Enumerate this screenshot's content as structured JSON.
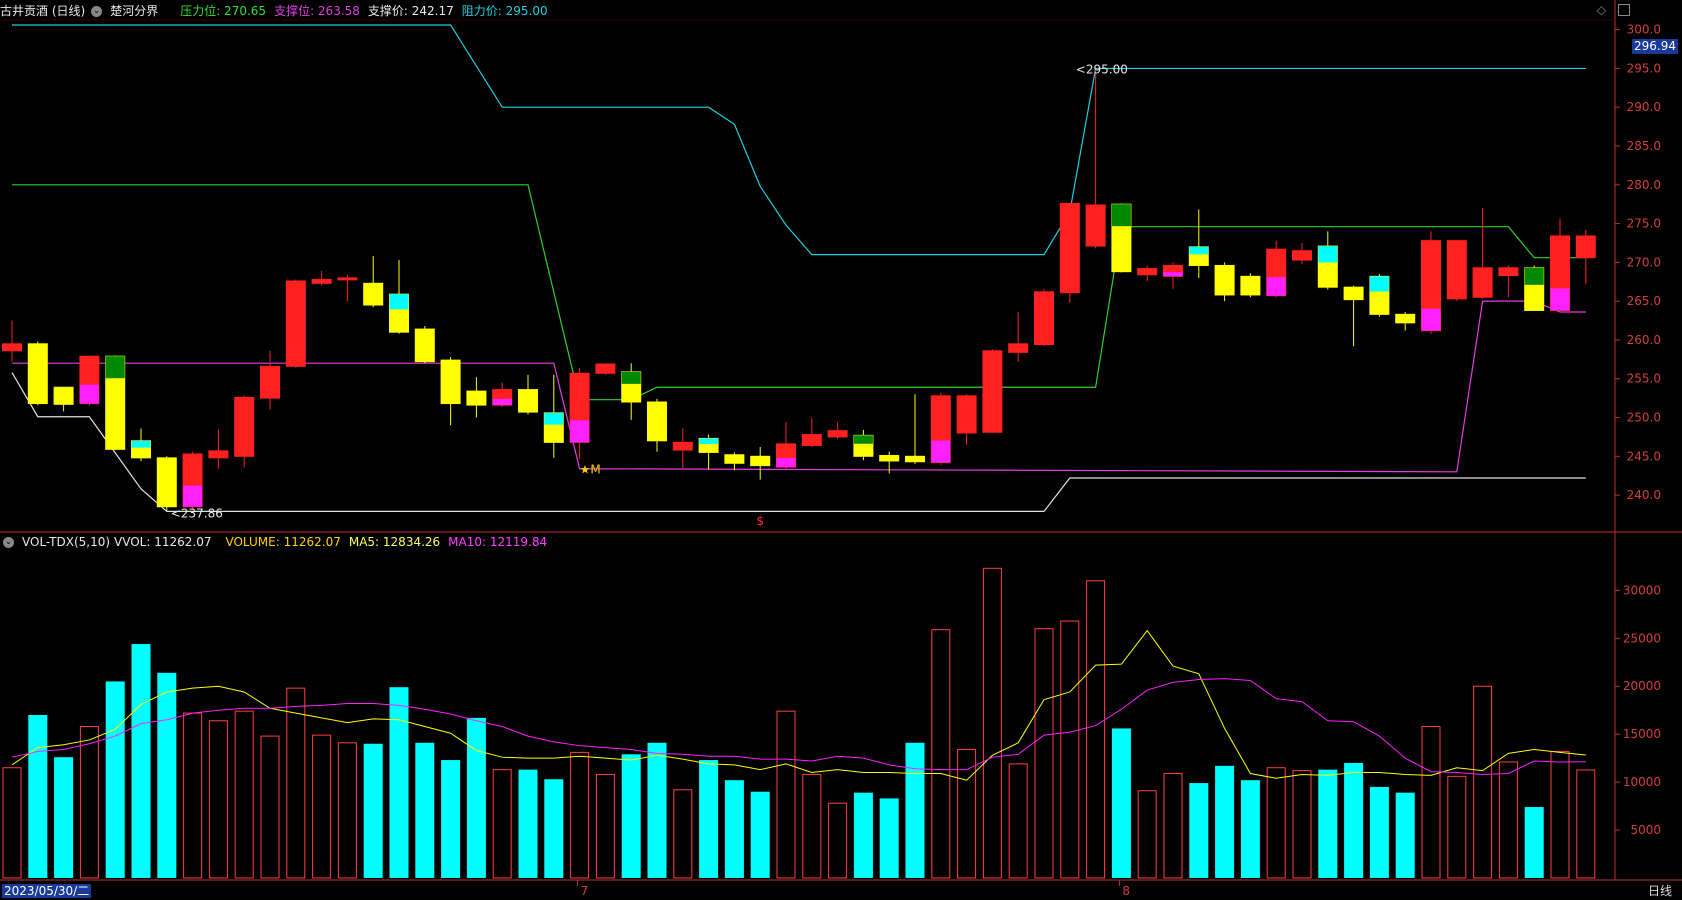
{
  "header": {
    "stock_title": "古井贡酒 (日线)",
    "indicator_name": "楚河分界",
    "pressure_label": "压力位: 270.65",
    "support_label": "支撑位: 263.58",
    "support_price_label": "支撑价: 242.17",
    "resistance_label": "阻力价: 295.00"
  },
  "volume_header": {
    "indicator_name": "VOL-TDX(5,10)",
    "vvol": "VVOL: 11262.07",
    "volume": "VOLUME: 11262.07",
    "ma5": "MA5: 12834.26",
    "ma10": "MA10: 12119.84"
  },
  "footer": {
    "date": "2023/05/30/二",
    "period": "日线",
    "month_marks": [
      {
        "index": 22,
        "label": "7"
      },
      {
        "index": 43,
        "label": "8"
      }
    ]
  },
  "current_price_tag": "296.94",
  "colors": {
    "up": "#ff2020",
    "down_yellow": "#ffff00",
    "cyan": "#00ffff",
    "magenta": "#ff20ff",
    "green": "#008800",
    "resistance_line": "#20d0e0",
    "pressure_line": "#30d030",
    "support_line": "#e040e0",
    "support_price_line": "#e0e0e0",
    "axis": "#c03030",
    "vol_up": "#ff4040",
    "vol_down": "#00ffff",
    "ma5": "#ffff00",
    "ma10": "#ff20ff"
  },
  "chart_data": {
    "type": "candlestick",
    "price_axis": {
      "ylim": [
        235.5,
        301.5
      ],
      "ticks": [
        240.0,
        245.0,
        250.0,
        255.0,
        260.0,
        265.0,
        270.0,
        275.0,
        280.0,
        285.0,
        290.0,
        295.0,
        300.0
      ]
    },
    "volume_axis": {
      "ylim": [
        0,
        34000
      ],
      "ticks": [
        5000,
        10000,
        15000,
        20000,
        25000,
        30000
      ]
    },
    "annotations": [
      {
        "index": 41,
        "price": 295.0,
        "text": "295.00"
      },
      {
        "index": 6,
        "price": 237.86,
        "text": "237.86"
      },
      {
        "index": 22,
        "price": 243.4,
        "text": "★M"
      },
      {
        "index": 29,
        "price": 236.8,
        "text": "$"
      }
    ],
    "candles": [
      {
        "o": 258.6,
        "h": 262.5,
        "l": 257.2,
        "c": 259.5,
        "v": 11500,
        "s": "red"
      },
      {
        "o": 259.5,
        "h": 259.8,
        "l": 251.6,
        "c": 251.8,
        "v": 17000,
        "s": "yellow"
      },
      {
        "o": 251.7,
        "h": 253.5,
        "l": 250.8,
        "c": 253.9,
        "v": 12600,
        "s": "yellow"
      },
      {
        "o": 251.8,
        "h": 258.0,
        "l": 251.5,
        "c": 257.9,
        "v": 15800,
        "s": "red",
        "ext": "magenta"
      },
      {
        "o": 257.9,
        "h": 258.0,
        "l": 245.8,
        "c": 245.9,
        "v": 20500,
        "s": "yellow",
        "ext": "green"
      },
      {
        "o": 247.0,
        "h": 248.6,
        "l": 244.4,
        "c": 244.8,
        "v": 24400,
        "s": "yellow",
        "ext": "cyan"
      },
      {
        "o": 244.8,
        "h": 245.0,
        "l": 238.0,
        "c": 238.5,
        "v": 21400,
        "s": "yellow"
      },
      {
        "o": 238.5,
        "h": 245.6,
        "l": 238.2,
        "c": 245.3,
        "v": 17200,
        "s": "red",
        "ext": "magenta"
      },
      {
        "o": 244.8,
        "h": 248.5,
        "l": 243.4,
        "c": 245.7,
        "v": 16400,
        "s": "red"
      },
      {
        "o": 245.0,
        "h": 252.8,
        "l": 243.6,
        "c": 252.6,
        "v": 17400,
        "s": "red"
      },
      {
        "o": 252.5,
        "h": 258.6,
        "l": 251.0,
        "c": 256.6,
        "v": 14800,
        "s": "red"
      },
      {
        "o": 256.6,
        "h": 267.8,
        "l": 256.4,
        "c": 267.6,
        "v": 19800,
        "s": "red"
      },
      {
        "o": 267.3,
        "h": 268.9,
        "l": 267.0,
        "c": 267.8,
        "v": 14900,
        "s": "red"
      },
      {
        "o": 268.0,
        "h": 268.4,
        "l": 265.0,
        "c": 267.8,
        "v": 14100,
        "s": "red"
      },
      {
        "o": 267.3,
        "h": 270.8,
        "l": 264.2,
        "c": 264.5,
        "v": 14000,
        "s": "yellow"
      },
      {
        "o": 265.9,
        "h": 270.3,
        "l": 260.8,
        "c": 261.0,
        "v": 19900,
        "s": "yellow",
        "ext": "cyan"
      },
      {
        "o": 261.4,
        "h": 261.8,
        "l": 257.0,
        "c": 257.2,
        "v": 14100,
        "s": "yellow"
      },
      {
        "o": 257.4,
        "h": 257.8,
        "l": 249.0,
        "c": 251.8,
        "v": 12300,
        "s": "yellow"
      },
      {
        "o": 253.4,
        "h": 255.2,
        "l": 250.0,
        "c": 251.6,
        "v": 16700,
        "s": "yellow"
      },
      {
        "o": 251.6,
        "h": 254.5,
        "l": 251.4,
        "c": 253.6,
        "v": 11300,
        "s": "red",
        "ext": "magenta"
      },
      {
        "o": 253.6,
        "h": 255.5,
        "l": 250.4,
        "c": 250.7,
        "v": 11300,
        "s": "yellow"
      },
      {
        "o": 250.6,
        "h": 255.5,
        "l": 244.8,
        "c": 246.8,
        "v": 10300,
        "s": "yellow",
        "ext": "cyan"
      },
      {
        "o": 246.8,
        "h": 256.4,
        "l": 244.6,
        "c": 255.7,
        "v": 13100,
        "s": "red",
        "ext": "magenta"
      },
      {
        "o": 255.7,
        "h": 256.9,
        "l": 255.5,
        "c": 256.9,
        "v": 10800,
        "s": "red"
      },
      {
        "o": 255.9,
        "h": 257.0,
        "l": 249.7,
        "c": 252.0,
        "v": 12900,
        "s": "yellow",
        "ext": "green"
      },
      {
        "o": 252.0,
        "h": 252.4,
        "l": 245.6,
        "c": 247.0,
        "v": 14100,
        "s": "yellow"
      },
      {
        "o": 246.8,
        "h": 248.6,
        "l": 243.5,
        "c": 245.8,
        "v": 9200,
        "s": "red"
      },
      {
        "o": 247.3,
        "h": 247.8,
        "l": 243.3,
        "c": 245.5,
        "v": 12300,
        "s": "yellow",
        "ext": "cyan"
      },
      {
        "o": 245.2,
        "h": 245.5,
        "l": 243.2,
        "c": 244.1,
        "v": 10200,
        "s": "yellow"
      },
      {
        "o": 245.0,
        "h": 246.2,
        "l": 242.0,
        "c": 243.8,
        "v": 9000,
        "s": "yellow"
      },
      {
        "o": 243.6,
        "h": 249.4,
        "l": 243.4,
        "c": 246.6,
        "v": 17400,
        "s": "red",
        "ext": "magenta"
      },
      {
        "o": 246.4,
        "h": 249.9,
        "l": 246.2,
        "c": 247.8,
        "v": 10800,
        "s": "red"
      },
      {
        "o": 247.5,
        "h": 249.4,
        "l": 247.2,
        "c": 248.3,
        "v": 7800,
        "s": "red"
      },
      {
        "o": 247.7,
        "h": 248.4,
        "l": 244.5,
        "c": 245.0,
        "v": 8900,
        "s": "yellow",
        "ext": "green"
      },
      {
        "o": 245.1,
        "h": 245.6,
        "l": 242.8,
        "c": 244.4,
        "v": 8300,
        "s": "yellow"
      },
      {
        "o": 245.0,
        "h": 253.0,
        "l": 244.0,
        "c": 244.3,
        "v": 14100,
        "s": "yellow"
      },
      {
        "o": 244.2,
        "h": 253.2,
        "l": 243.9,
        "c": 252.8,
        "v": 25900,
        "s": "red",
        "ext": "magenta"
      },
      {
        "o": 248.0,
        "h": 253.0,
        "l": 246.5,
        "c": 252.8,
        "v": 13400,
        "s": "red"
      },
      {
        "o": 248.1,
        "h": 258.8,
        "l": 248.0,
        "c": 258.6,
        "v": 32300,
        "s": "red"
      },
      {
        "o": 258.4,
        "h": 263.6,
        "l": 257.2,
        "c": 259.5,
        "v": 11900,
        "s": "red"
      },
      {
        "o": 259.4,
        "h": 266.6,
        "l": 259.2,
        "c": 266.2,
        "v": 26000,
        "s": "red"
      },
      {
        "o": 266.1,
        "h": 277.6,
        "l": 264.8,
        "c": 277.6,
        "v": 26800,
        "s": "red"
      },
      {
        "o": 277.4,
        "h": 295.0,
        "l": 271.8,
        "c": 272.1,
        "v": 31000,
        "s": "red"
      },
      {
        "o": 277.5,
        "h": 277.6,
        "l": 268.7,
        "c": 268.8,
        "v": 15600,
        "s": "yellow",
        "ext": "green"
      },
      {
        "o": 269.2,
        "h": 269.6,
        "l": 267.6,
        "c": 268.4,
        "v": 9100,
        "s": "red"
      },
      {
        "o": 268.2,
        "h": 270.0,
        "l": 266.6,
        "c": 269.6,
        "v": 10900,
        "s": "red",
        "ext": "magenta"
      },
      {
        "o": 272.0,
        "h": 276.8,
        "l": 268.0,
        "c": 269.6,
        "v": 9900,
        "s": "yellow",
        "ext": "cyan"
      },
      {
        "o": 269.6,
        "h": 270.0,
        "l": 265.0,
        "c": 265.8,
        "v": 11700,
        "s": "yellow"
      },
      {
        "o": 265.8,
        "h": 268.6,
        "l": 265.5,
        "c": 268.2,
        "v": 10200,
        "s": "yellow"
      },
      {
        "o": 265.7,
        "h": 272.8,
        "l": 265.5,
        "c": 271.7,
        "v": 11500,
        "s": "red",
        "ext": "magenta"
      },
      {
        "o": 270.3,
        "h": 272.5,
        "l": 269.8,
        "c": 271.5,
        "v": 11200,
        "s": "red"
      },
      {
        "o": 272.1,
        "h": 274.0,
        "l": 266.5,
        "c": 266.8,
        "v": 11300,
        "s": "yellow",
        "ext": "cyan"
      },
      {
        "o": 266.8,
        "h": 267.0,
        "l": 259.2,
        "c": 265.2,
        "v": 12000,
        "s": "yellow"
      },
      {
        "o": 268.2,
        "h": 268.5,
        "l": 263.0,
        "c": 263.3,
        "v": 9500,
        "s": "yellow",
        "ext": "cyan"
      },
      {
        "o": 263.3,
        "h": 263.6,
        "l": 261.2,
        "c": 262.2,
        "v": 8900,
        "s": "yellow"
      },
      {
        "o": 261.2,
        "h": 274.0,
        "l": 260.8,
        "c": 272.8,
        "v": 15800,
        "s": "red",
        "ext": "magenta"
      },
      {
        "o": 265.3,
        "h": 272.8,
        "l": 265.0,
        "c": 272.8,
        "v": 10600,
        "s": "red"
      },
      {
        "o": 265.5,
        "h": 277.0,
        "l": 265.3,
        "c": 269.3,
        "v": 20000,
        "s": "red"
      },
      {
        "o": 268.3,
        "h": 269.6,
        "l": 265.5,
        "c": 269.3,
        "v": 12100,
        "s": "red"
      },
      {
        "o": 269.3,
        "h": 269.6,
        "l": 264.2,
        "c": 263.8,
        "v": 7400,
        "s": "yellow",
        "ext": "green"
      },
      {
        "o": 263.8,
        "h": 275.6,
        "l": 263.6,
        "c": 273.4,
        "v": 13200,
        "s": "red",
        "ext": "magenta"
      },
      {
        "o": 270.6,
        "h": 274.2,
        "l": 267.2,
        "c": 273.4,
        "v": 11262,
        "s": "red"
      }
    ],
    "resistance_line": [
      {
        "i": 0,
        "p": 300.6
      },
      {
        "i": 17,
        "p": 300.6
      },
      {
        "i": 19,
        "p": 290.0
      },
      {
        "i": 27,
        "p": 290.0
      },
      {
        "i": 28,
        "p": 287.8
      },
      {
        "i": 29,
        "p": 279.8
      },
      {
        "i": 30,
        "p": 274.8
      },
      {
        "i": 31,
        "p": 271.0
      },
      {
        "i": 40,
        "p": 271.0
      },
      {
        "i": 41,
        "p": 276.5
      },
      {
        "i": 42,
        "p": 295.0
      },
      {
        "i": 61,
        "p": 295.0
      }
    ],
    "pressure_line": [
      {
        "i": 0,
        "p": 280.0
      },
      {
        "i": 20,
        "p": 280.0
      },
      {
        "i": 22,
        "p": 252.3
      },
      {
        "i": 24,
        "p": 252.3
      },
      {
        "i": 25,
        "p": 253.9
      },
      {
        "i": 42,
        "p": 253.9
      },
      {
        "i": 43,
        "p": 274.6
      },
      {
        "i": 58,
        "p": 274.6
      },
      {
        "i": 59,
        "p": 270.6
      },
      {
        "i": 61,
        "p": 270.6
      }
    ],
    "support_line": [
      {
        "i": 0,
        "p": 257.0
      },
      {
        "i": 21,
        "p": 257.0
      },
      {
        "i": 22,
        "p": 243.4
      },
      {
        "i": 56,
        "p": 243.0
      },
      {
        "i": 57,
        "p": 265.0
      },
      {
        "i": 59,
        "p": 265.0
      },
      {
        "i": 60,
        "p": 263.6
      },
      {
        "i": 61,
        "p": 263.6
      }
    ],
    "support_price_line": [
      {
        "i": 0,
        "p": 255.8
      },
      {
        "i": 1,
        "p": 250.1
      },
      {
        "i": 3,
        "p": 250.1
      },
      {
        "i": 5,
        "p": 240.8
      },
      {
        "i": 6,
        "p": 237.9
      },
      {
        "i": 40,
        "p": 237.9
      },
      {
        "i": 41,
        "p": 242.2
      },
      {
        "i": 61,
        "p": 242.2
      }
    ],
    "ma5": [
      11800,
      13600,
      13900,
      14400,
      15500,
      18100,
      19400,
      19800,
      20000,
      19400,
      17700,
      17200,
      16700,
      16200,
      16600,
      16500,
      15800,
      15100,
      13300,
      12600,
      12500,
      12500,
      12700,
      12500,
      12300,
      12800,
      12400,
      11900,
      11800,
      11300,
      11900,
      11000,
      11300,
      11000,
      11000,
      10900,
      10900,
      10200,
      12800,
      14100,
      18600,
      19400,
      22200,
      22300,
      25800,
      22100,
      21300,
      15600,
      10900,
      10400,
      10800,
      10700,
      11000,
      11000,
      10800,
      10700,
      11500,
      11200,
      13000,
      13400,
      13100,
      12834
    ],
    "ma10": [
      12600,
      13200,
      13400,
      14000,
      14800,
      16100,
      16500,
      17200,
      17500,
      17700,
      17700,
      17900,
      18000,
      18200,
      18200,
      18000,
      17600,
      17100,
      16400,
      15800,
      14800,
      14200,
      13800,
      13600,
      13400,
      13000,
      12900,
      12700,
      12700,
      12400,
      12400,
      12200,
      12700,
      12500,
      11800,
      11400,
      11300,
      11300,
      12600,
      12900,
      14900,
      15200,
      15900,
      17600,
      19600,
      20400,
      20700,
      20800,
      20600,
      18700,
      18400,
      16400,
      16300,
      14800,
      12500,
      11100,
      11000,
      10800,
      10900,
      12200,
      12100,
      12120
    ]
  }
}
